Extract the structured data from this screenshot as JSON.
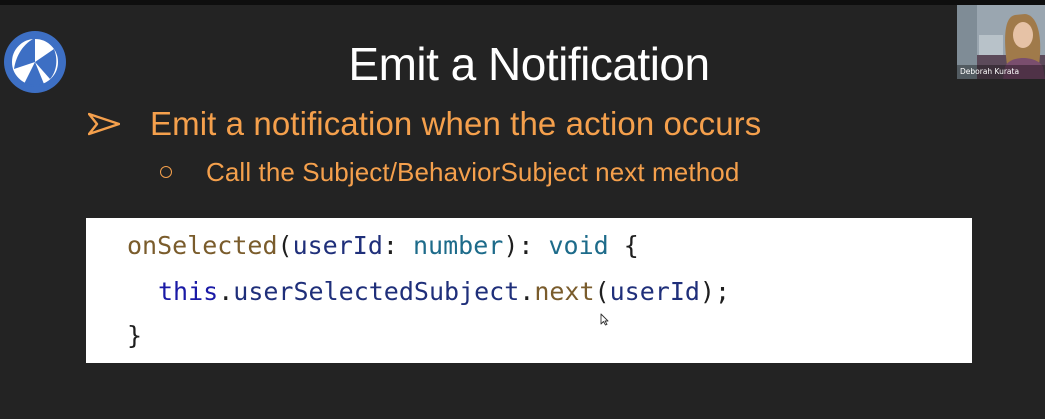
{
  "slide": {
    "title": "Emit a Notification",
    "bullet": {
      "marker_icon": "arrowhead-bullet-icon",
      "text": "Emit a notification when the action occurs"
    },
    "sub_bullet": {
      "marker_icon": "hollow-circle-bullet-icon",
      "text": "Call the Subject/BehaviorSubject next method"
    },
    "code": {
      "line1": {
        "fn": "onSelected",
        "open_paren": "(",
        "param": "userId",
        "colon": ": ",
        "type": "number",
        "close": "): ",
        "return_type": "void",
        "brace": " {"
      },
      "line2": {
        "keyword": "this",
        "dot1": ".",
        "member": "userSelectedSubject",
        "dot2": ".",
        "method": "next",
        "open_paren": "(",
        "arg": "userId",
        "close": ");"
      },
      "line3": {
        "brace": "}"
      }
    }
  },
  "presenter": {
    "name": "Deborah Kurata"
  },
  "icons": {
    "logo": "beach-ball-logo-icon",
    "cursor": "mouse-pointer-icon"
  },
  "colors": {
    "background": "#232323",
    "title": "#ffffff",
    "accent_orange": "#f5a04c",
    "logo_blue": "#3d6fc4",
    "code_background": "#ffffff"
  }
}
